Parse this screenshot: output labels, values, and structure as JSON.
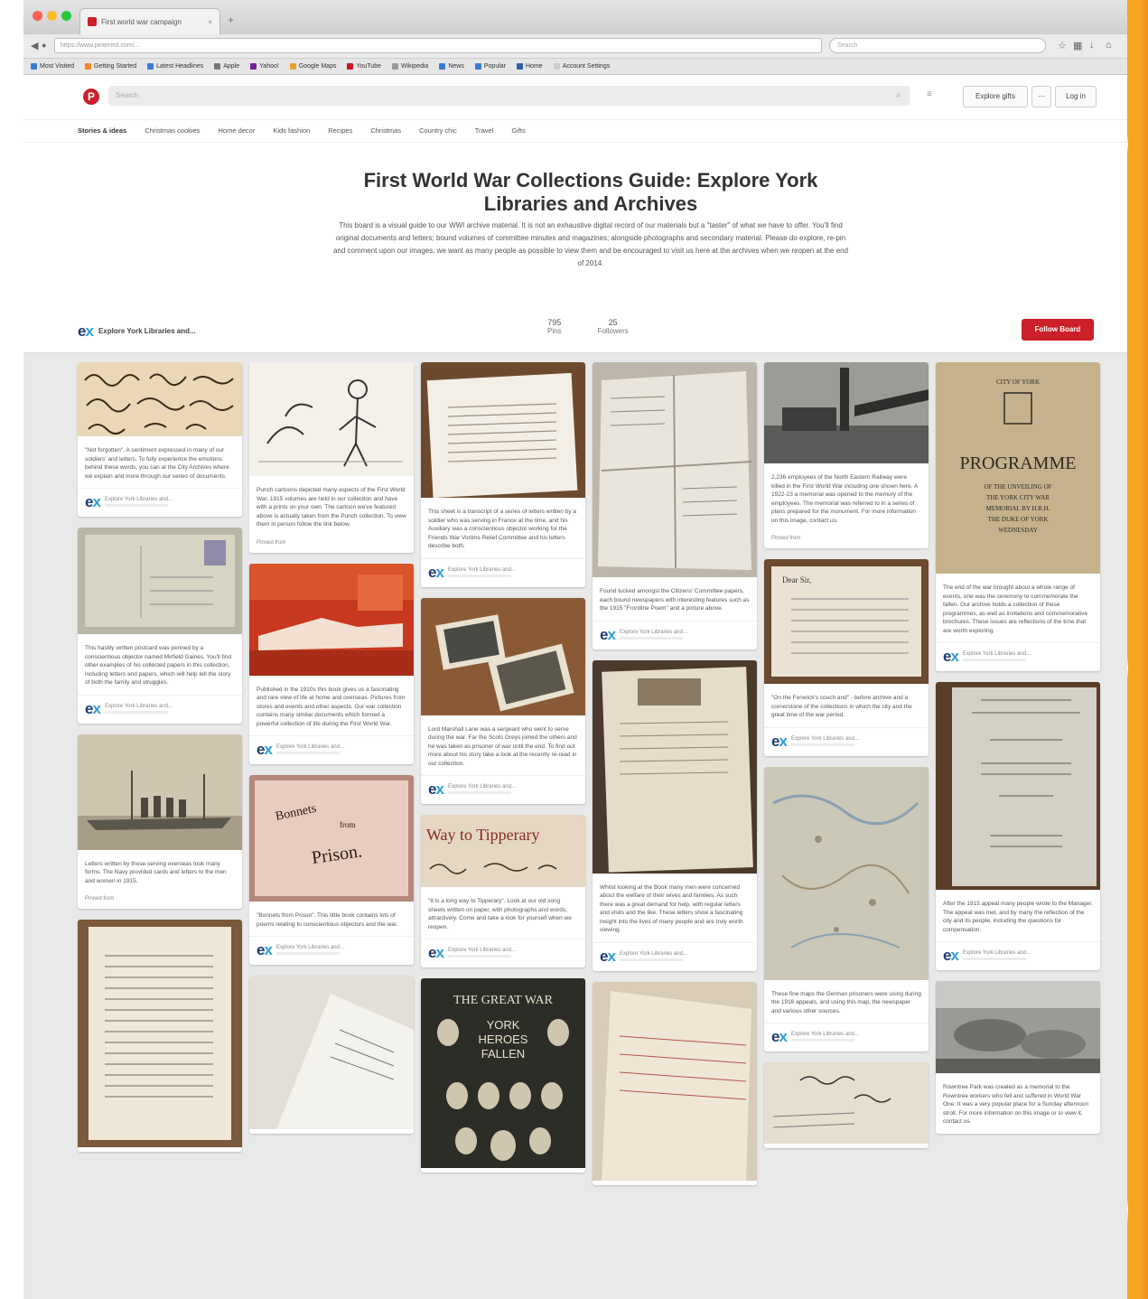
{
  "browser": {
    "tab_title": "First world war campaign",
    "url": "https://www.pinterest.com/...",
    "search_placeholder": "Search",
    "bookmarks": [
      "Most Visited",
      "Getting Started",
      "Latest Headlines",
      "Apple",
      "Yahoo!",
      "Google Maps",
      "YouTube",
      "Wikipedia",
      "News",
      "Popular",
      "Home",
      "Account Settings"
    ]
  },
  "header": {
    "search_placeholder": "Search",
    "explore_label": "Explore gifts",
    "login_label": "Log in"
  },
  "categories": [
    "Stories & ideas",
    "Christmas cookies",
    "Home decor",
    "Kids fashion",
    "Recipes",
    "Christmas",
    "Country chic",
    "Travel",
    "Gifts"
  ],
  "board": {
    "title": "First World War Collections Guide: Explore York Libraries and Archives",
    "description": "This board is a visual guide to our WWI archive material. It is not an exhaustive digital record of our materials but a \"taster\" of what we have to offer. You'll find original documents and letters; bound volumes of committee minutes and magazines; alongside photographs and secondary material. Please do explore, re-pin and comment upon our images, we want as many people as possible to view them and be encouraged to visit us here at the archives when we reopen at the end of 2014.",
    "owner": "Explore York Libraries and...",
    "pins_count": "795",
    "pins_label": "Pins",
    "followers_count": "25",
    "followers_label": "Followers",
    "follow_label": "Follow Board"
  },
  "pins": [
    {
      "desc": "\"Not forgotten\". A sentiment expressed in many of our soldiers' and letters. To fully experience the emotions behind these words, you can at the City Archives where we explain and more through our series of documents."
    },
    {
      "desc": "Punch cartoons depicted many aspects of the First World War. 1915 volumes are held in our collection and have with a prints on your own. The cartoon we've featured above is actually taken from the Punch collection. To view them in person follow the link below."
    },
    {
      "desc": "This sheet is a transcript of a series of letters written by a soldier who was serving in France at the time, and his Auxiliary was a conscientious objector working for the Friends War Victims Relief Committee and his letters describe both."
    },
    {
      "desc": "Found tucked amongst the Citizens' Committee papers, each bound newspapers with interesting features such as the 1915 \"Frontline Poem\" and a picture above."
    },
    {
      "desc": "2,236 employees of the North Eastern Railway were killed in the First World War including one shown here. A 1922-23 a memorial was opened to the memory of the employees. The memorial was referred to in a series of plans prepared for the monument. For more information on this image, contact us."
    },
    {
      "desc": "The end of the war brought about a whole range of events, one was the ceremony to commemorate the fallen. Our archive holds a collection of these programmes, as well as invitations and commemorative brochures. These issues are reflections of the time that are worth exploring."
    },
    {
      "desc": "This hastily written postcard was penned by a conscientious objector named Mirfield Gaines. You'll find other examples of his collected papers in this collection, including letters and papers, which will help tell the story of both the family and struggles."
    },
    {
      "desc": "Published in the 1910s this book gives us a fascinating and rare view of life at home and overseas. Pictures from stores and events and other aspects. Our war collection contains many similar documents which formed a powerful collection of life during the First World War."
    },
    {
      "desc": "Lord Marshall Lane was a sergeant who went to serve during the war. Far the Scots Greys joined the others and he was taken as prisoner of war until the end. To find out more about his story take a look at the recently re-read in our collection."
    },
    {
      "desc": "Whilst looking at the Book many men were concerned about the welfare of their wives and families. As such there was a great demand for help, with regular letters and visits and the like. These letters show a fascinating insight into the lives of many people and are truly worth viewing."
    },
    {
      "desc": "\"On the Fenwick's couch and\" - before archive and a cornerstone of the collections in which the city and the great time of the war period."
    },
    {
      "desc": "After the 1915 appeal many people wrote to the Manager. The appeal was met, and by many the reflection of the city and its people, including the questions for compensation."
    },
    {
      "desc": "Letters written by those serving overseas took many forms. The Navy provided cards and letters to the men and women in 1915."
    },
    {
      "desc": "\"Bonnets from Prison\". This little book contains lots of poems relating to conscientious objectors and the war."
    },
    {
      "desc": "\"It is a long way to Tipperary\". Look at our old song sheets written on paper, with photographs and words, attractively. Come and take a look for yourself when we reopen."
    },
    {
      "desc": "These fine maps the German prisoners were using during the 1916 appeals, and using this map, the newspaper and various other sources."
    },
    {
      "desc": "Rowntree Park was created as a memorial to the Rowntree workers who fell and suffered in World War One. It was a very popular place for a Sunday afternoon stroll. For more information on this image or to view it, contact us."
    }
  ],
  "source_label": "Explore York Libraries and...",
  "credits": [
    "Pinned from",
    "Pinned from"
  ]
}
